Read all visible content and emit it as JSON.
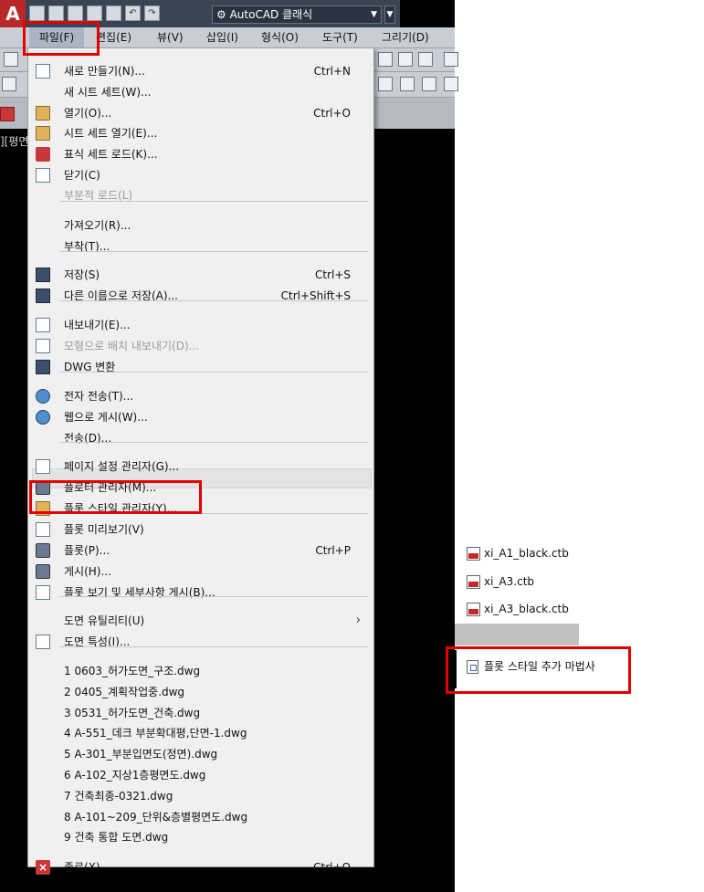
{
  "quick_access": {
    "app_button": "A",
    "workspace": "AutoCAD 클래식"
  },
  "menubar": {
    "file": "파일(F)",
    "edit": "편집(E)",
    "view": "뷰(V)",
    "insert": "삽입(I)",
    "format": "형식(O)",
    "tools": "도구(T)",
    "draw": "그리기(D)"
  },
  "viewport_label": "][평면",
  "file_menu": [
    {
      "label": "새로 만들기(N)...",
      "shortcut": "Ctrl+N",
      "icon": "new-document-icon"
    },
    {
      "label": "새 시트 세트(W)...",
      "shortcut": "",
      "icon": ""
    },
    {
      "label": "열기(O)...",
      "shortcut": "Ctrl+O",
      "icon": "open-folder-icon"
    },
    {
      "label": "시트 세트 열기(E)...",
      "shortcut": "",
      "icon": "sheet-set-icon"
    },
    {
      "label": "표식 세트 로드(K)...",
      "shortcut": "",
      "icon": "markup-icon"
    },
    {
      "label": "닫기(C)",
      "shortcut": "",
      "icon": "close-document-icon"
    },
    {
      "label": "부분적 로드(L)",
      "shortcut": "",
      "icon": "",
      "disabled": true
    },
    {
      "label": "가져오기(R)...",
      "shortcut": "",
      "icon": ""
    },
    {
      "label": "부착(T)...",
      "shortcut": "",
      "icon": ""
    },
    {
      "label": "저장(S)",
      "shortcut": "Ctrl+S",
      "icon": "save-icon"
    },
    {
      "label": "다른 이름으로 저장(A)...",
      "shortcut": "Ctrl+Shift+S",
      "icon": "save-as-icon"
    },
    {
      "label": "내보내기(E)...",
      "shortcut": "",
      "icon": "export-icon"
    },
    {
      "label": "모형으로 배치 내보내기(D)...",
      "shortcut": "",
      "icon": "export-layout-icon",
      "disabled": true
    },
    {
      "label": "DWG 변환",
      "shortcut": "",
      "icon": "dwg-convert-icon"
    },
    {
      "label": "전자 전송(T)...",
      "shortcut": "",
      "icon": "etransmit-icon"
    },
    {
      "label": "웹으로 게시(W)...",
      "shortcut": "",
      "icon": "publish-web-icon"
    },
    {
      "label": "전송(D)...",
      "shortcut": "",
      "icon": ""
    },
    {
      "label": "페이지 설정 관리자(G)...",
      "shortcut": "",
      "icon": "page-setup-icon"
    },
    {
      "label": "플로터 관리자(M)...",
      "shortcut": "",
      "icon": "plotter-manager-icon"
    },
    {
      "label": "플롯 스타일 관리자(Y)...",
      "shortcut": "",
      "icon": "plot-style-manager-icon"
    },
    {
      "label": "플롯 미리보기(V)",
      "shortcut": "",
      "icon": "plot-preview-icon"
    },
    {
      "label": "플롯(P)...",
      "shortcut": "Ctrl+P",
      "icon": "plot-icon"
    },
    {
      "label": "게시(H)...",
      "shortcut": "",
      "icon": "publish-icon"
    },
    {
      "label": "플롯 보기 및 세부사항 게시(B)...",
      "shortcut": "",
      "icon": "plot-details-icon"
    },
    {
      "label": "도면 유틸리티(U)",
      "shortcut": "",
      "icon": "",
      "submenu": true
    },
    {
      "label": "도면 특성(I)...",
      "shortcut": "",
      "icon": "drawing-properties-icon"
    },
    {
      "label": "1 0603_허가도면_구조.dwg",
      "shortcut": "",
      "icon": ""
    },
    {
      "label": "2 0405_계획작업중.dwg",
      "shortcut": "",
      "icon": ""
    },
    {
      "label": "3 0531_허가도면_건축.dwg",
      "shortcut": "",
      "icon": ""
    },
    {
      "label": "4 A-551_데크 부분확대평,단면-1.dwg",
      "shortcut": "",
      "icon": ""
    },
    {
      "label": "5 A-301_부분입면도(정면).dwg",
      "shortcut": "",
      "icon": ""
    },
    {
      "label": "6 A-102_지상1층평면도.dwg",
      "shortcut": "",
      "icon": ""
    },
    {
      "label": "7 건축최종-0321.dwg",
      "shortcut": "",
      "icon": ""
    },
    {
      "label": "8 A-101~209_단위&층별평면도.dwg",
      "shortcut": "",
      "icon": ""
    },
    {
      "label": "9 건축 통합 도면.dwg",
      "shortcut": "",
      "icon": ""
    },
    {
      "label": "종료(X)",
      "shortcut": "Ctrl+Q",
      "icon": "exit-icon"
    }
  ],
  "plot_style_files": [
    {
      "name": "xi_A1_black.ctb"
    },
    {
      "name": "xi_A3.ctb"
    },
    {
      "name": "xi_A3_black.ctb"
    }
  ],
  "wizard": {
    "label": "플롯 스타일 추가 마법사"
  },
  "colors": {
    "highlight": "#e30000",
    "ctb_red": "#c62828"
  }
}
